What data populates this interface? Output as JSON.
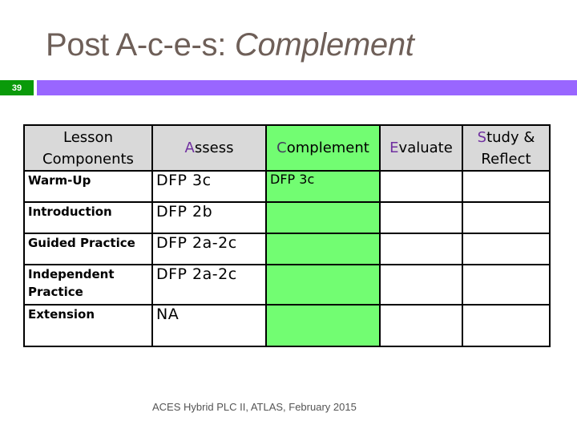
{
  "slide": {
    "title_plain": "Post A-c-e-s: ",
    "title_italic": "Complement",
    "number": "39",
    "footer": "ACES Hybrid PLC II, ATLAS, February 2015"
  },
  "colors": {
    "title": "#6e5f58",
    "slide_number_bg": "#0a9a0a",
    "accent_bar": "#9966ff",
    "header_bg": "#d9d9d9",
    "highlight_column": "#72fd72",
    "initial_letter": "#7030a0"
  },
  "table": {
    "headers": [
      {
        "text": "Lesson Components"
      },
      {
        "initial": "A",
        "rest": "ssess"
      },
      {
        "initial": "C",
        "rest": "omplement"
      },
      {
        "initial": "E",
        "rest": "valuate"
      },
      {
        "initial": "S",
        "rest": "tudy & Reflect"
      }
    ],
    "rows": [
      {
        "component": "Warm-Up",
        "assess": "DFP 3c",
        "complement": "DFP 3c",
        "evaluate": "",
        "study_reflect": ""
      },
      {
        "component": "Introduction",
        "assess": "DFP 2b",
        "complement": "",
        "evaluate": "",
        "study_reflect": ""
      },
      {
        "component": "Guided Practice",
        "assess": "DFP 2a-2c",
        "complement": "",
        "evaluate": "",
        "study_reflect": ""
      },
      {
        "component": "Independent Practice",
        "assess": "DFP 2a-2c",
        "complement": "",
        "evaluate": "",
        "study_reflect": ""
      },
      {
        "component": "Extension",
        "assess": "NA",
        "complement": "",
        "evaluate": "",
        "study_reflect": ""
      }
    ]
  }
}
